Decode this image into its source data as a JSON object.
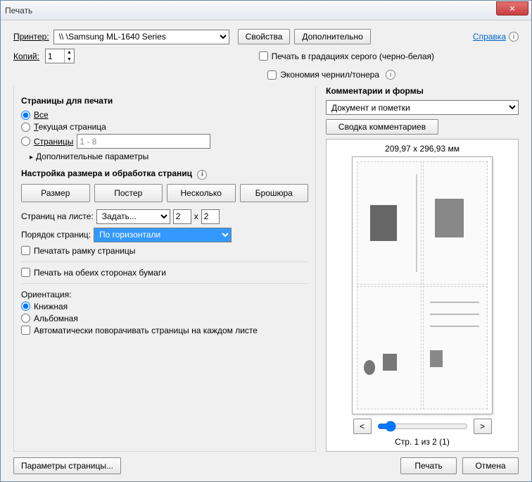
{
  "window": {
    "title": "Печать"
  },
  "header": {
    "printer_label": "Принтер:",
    "printer_value": "\\\\            \\Samsung ML-1640 Series",
    "properties_btn": "Свойства",
    "advanced_btn": "Дополнительно",
    "help_link": "Справка",
    "copies_label": "Копий:",
    "copies_value": "1",
    "grayscale_label": "Печать в градациях серого (черно-белая)",
    "save_ink_label": "Экономия чернил/тонера"
  },
  "pages": {
    "title": "Страницы для печати",
    "all_label": "Все",
    "current_label": "Текущая страница",
    "range_label": "Страницы",
    "range_value": "1 - 8",
    "more_params": "Дополнительные параметры"
  },
  "sizing": {
    "title": "Настройка размера и обработка страниц",
    "tabs": {
      "size": "Размер",
      "poster": "Постер",
      "multiple": "Несколько",
      "booklet": "Брошюра"
    },
    "per_sheet_label": "Страниц на листе:",
    "per_sheet_option": "Задать...",
    "cols": "2",
    "x_label": "x",
    "rows": "2",
    "order_label": "Порядок страниц:",
    "order_value": "По горизонтали",
    "border_label": "Печатать рамку страницы"
  },
  "duplex": {
    "label": "Печать на обеих сторонах бумаги"
  },
  "orientation": {
    "title": "Ориентация:",
    "portrait": "Книжная",
    "landscape": "Альбомная",
    "autorotate": "Автоматически поворачивать страницы на каждом листе"
  },
  "comments": {
    "title": "Комментарии и формы",
    "select_value": "Документ и пометки",
    "summary_btn": "Сводка комментариев"
  },
  "preview": {
    "dimensions": "209,97 x 296,93 мм",
    "prev": "<",
    "next": ">",
    "page_text": "Стр. 1 из 2 (1)"
  },
  "footer": {
    "page_setup": "Параметры страницы...",
    "print": "Печать",
    "cancel": "Отмена"
  }
}
